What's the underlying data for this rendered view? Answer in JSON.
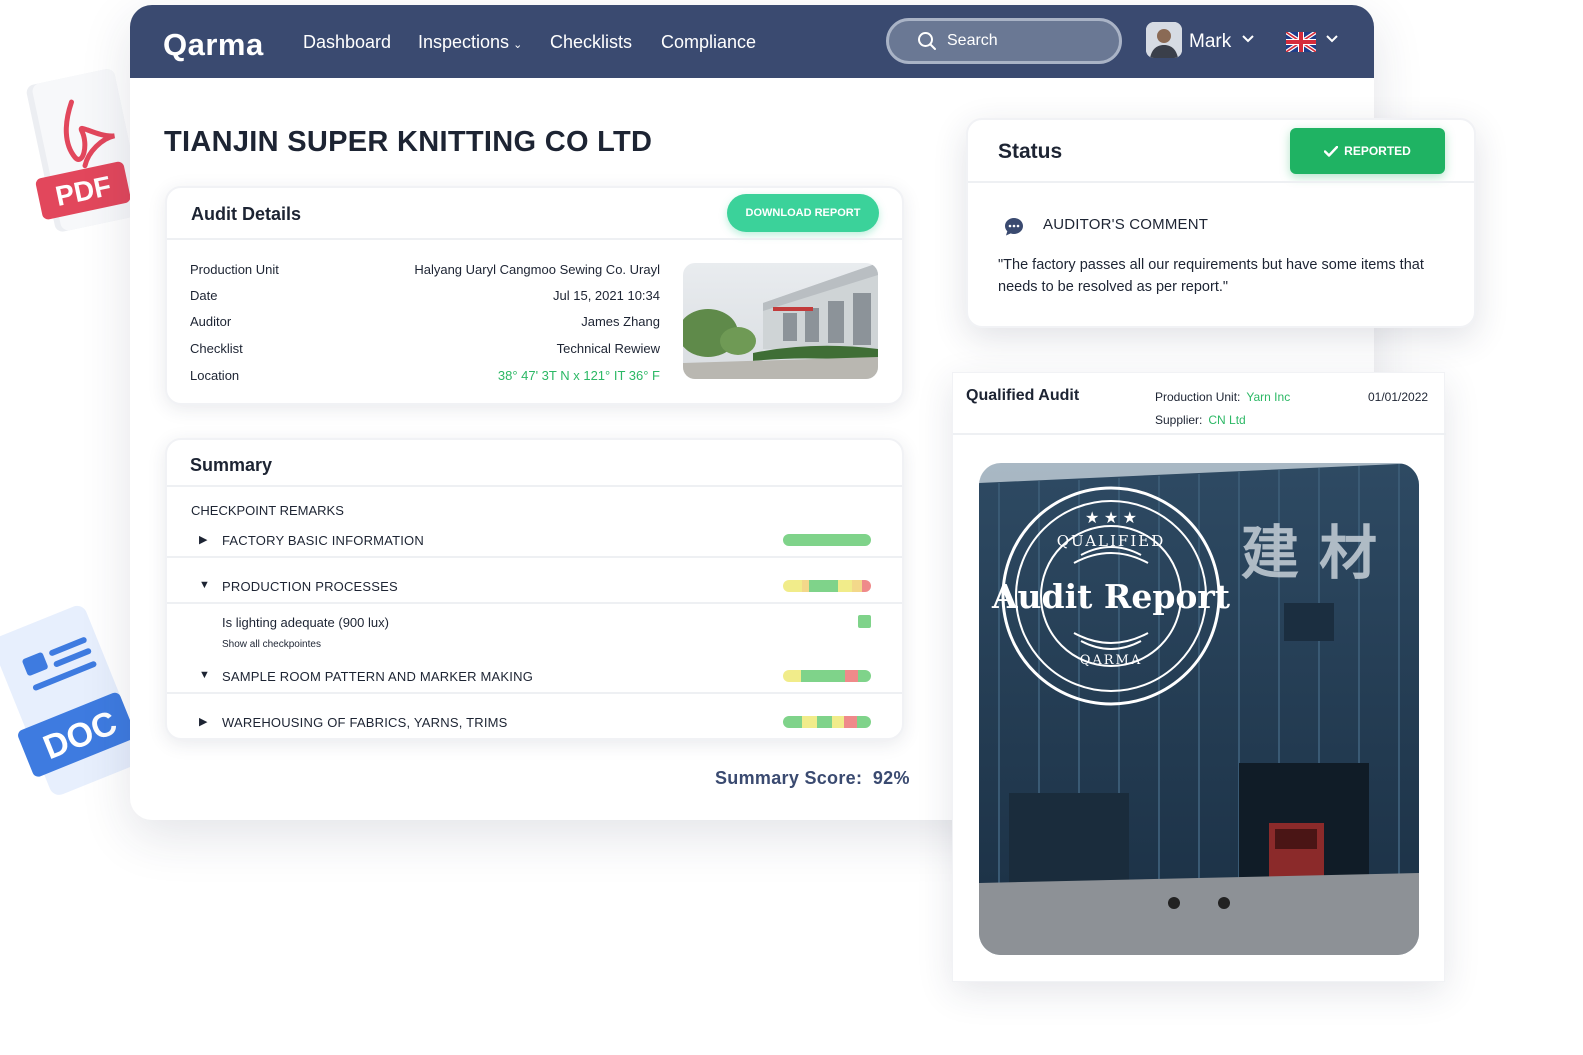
{
  "nav": {
    "logo": "Qarma",
    "links": [
      "Dashboard",
      "Inspections",
      "Checklists",
      "Compliance"
    ],
    "search_placeholder": "Search",
    "user_name": "Mark",
    "language_flag": "uk-flag-icon"
  },
  "company": {
    "name": "TIANJIN SUPER KNITTING CO LTD"
  },
  "audit_details": {
    "title": "Audit Details",
    "download_label": "DOWNLOAD REPORT",
    "rows": [
      {
        "label": "Production Unit",
        "value": "Halyang Uaryl Cangmoo Sewing Co. Urayl"
      },
      {
        "label": "Date",
        "value": "Jul 15, 2021 10:34"
      },
      {
        "label": "Auditor",
        "value": "James Zhang"
      },
      {
        "label": "Checklist",
        "value": "Technical Rewiew"
      },
      {
        "label": "Location",
        "value": "38° 47' 3T N x 121° IT 36° F"
      }
    ]
  },
  "summary": {
    "title": "Summary",
    "remarks_heading": "CHECKPOINT REMARKS",
    "sections": [
      {
        "label": "FACTORY BASIC INFORMATION",
        "expanded": false
      },
      {
        "label": "PRODUCTION PROCESSES",
        "expanded": true
      },
      {
        "label": "SAMPLE ROOM PATTERN AND MARKER MAKING",
        "expanded": true
      },
      {
        "label": "WAREHOUSING OF FABRICS, YARNS, TRIMS",
        "expanded": false
      }
    ],
    "checkpoint": {
      "label": "Is lighting adequate (900 lux)",
      "link": "Show all checkpointes"
    },
    "score_label": "Summary Score:",
    "score_value": "92%"
  },
  "status": {
    "title": "Status",
    "badge": "REPORTED",
    "comment_heading": "AUDITOR'S COMMENT",
    "comment_text": "\"The factory passes all our requirements but have some items that needs to be resolved as per report.\""
  },
  "qualified_audit": {
    "title": "Qualified Audit",
    "production_unit_label": "Production Unit:",
    "production_unit_value": "Yarn Inc",
    "supplier_label": "Supplier:",
    "supplier_value": "CN Ltd",
    "date": "01/01/2022",
    "stamp_top": "QUALIFIED",
    "stamp_main": "Audit Report",
    "stamp_bottom": "QARMA",
    "sign_chars": "建 材"
  },
  "files": {
    "pdf_label": "PDF",
    "doc_label": "DOC"
  },
  "colors": {
    "nav_bg": "#3a4a70",
    "accent_green": "#3bd29a",
    "reported_green": "#1fb363",
    "bar_green": "#7fd38a",
    "bar_yellow": "#f1ec8a",
    "bar_red": "#ef8a8a",
    "bar_tan": "#f3d88a"
  }
}
